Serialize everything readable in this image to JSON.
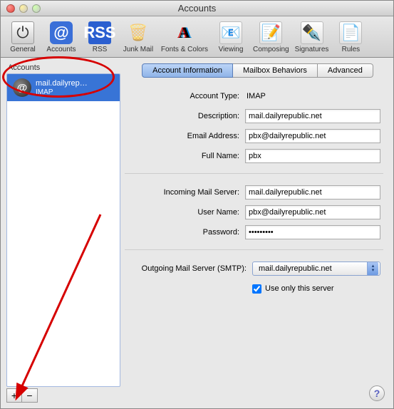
{
  "window": {
    "title": "Accounts"
  },
  "toolbar": {
    "general": "General",
    "accounts": "Accounts",
    "rss": "RSS",
    "rss_badge": "RSS",
    "junk": "Junk Mail",
    "fonts": "Fonts & Colors",
    "viewing": "Viewing",
    "composing": "Composing",
    "signatures": "Signatures",
    "rules": "Rules"
  },
  "sidebar": {
    "header": "Accounts",
    "account": {
      "name": "mail.dailyrep…",
      "protocol": "IMAP"
    },
    "add": "+",
    "remove": "−"
  },
  "tabs": {
    "info": "Account Information",
    "mailbox": "Mailbox Behaviors",
    "advanced": "Advanced"
  },
  "form": {
    "account_type_label": "Account Type:",
    "account_type_value": "IMAP",
    "description_label": "Description:",
    "description_value": "mail.dailyrepublic.net",
    "email_label": "Email Address:",
    "email_value": "pbx@dailyrepublic.net",
    "fullname_label": "Full Name:",
    "fullname_value": "pbx",
    "incoming_label": "Incoming Mail Server:",
    "incoming_value": "mail.dailyrepublic.net",
    "username_label": "User Name:",
    "username_value": "pbx@dailyrepublic.net",
    "password_label": "Password:",
    "password_value": "•••••••••",
    "smtp_label": "Outgoing Mail Server (SMTP):",
    "smtp_value": "mail.dailyrepublic.net",
    "useonly_label": "Use only this server"
  },
  "help": "?"
}
